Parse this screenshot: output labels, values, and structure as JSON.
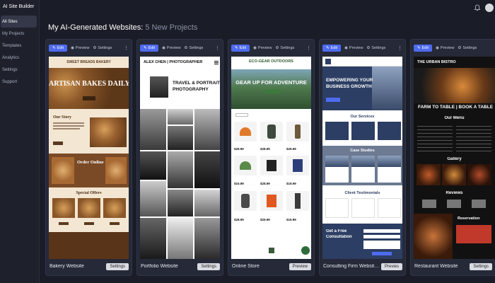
{
  "sidebar": {
    "brand": "AI Site Builder",
    "items": [
      {
        "label": "All Sites",
        "active": true
      },
      {
        "label": "My Projects",
        "active": false
      },
      {
        "label": "Templates",
        "active": false
      },
      {
        "label": "Analytics",
        "active": false
      },
      {
        "label": "Settings",
        "active": false
      },
      {
        "label": "Support",
        "active": false
      }
    ]
  },
  "header": {
    "title": "My AI-Generated Websites:",
    "subtitle": "5 New Projects"
  },
  "toolbar": {
    "edit": "Edit",
    "preview": "Preview",
    "settings": "Settings"
  },
  "cards": [
    {
      "name": "Bakery Website",
      "button": "Settings",
      "site": {
        "brand": "SWEET BREADS BAKERY",
        "hero": "ARTISAN BAKES DAILY",
        "story": "Our Story",
        "online": "Order Online",
        "offers": "Special Offers"
      }
    },
    {
      "name": "Portfolio Website",
      "button": "Settings",
      "site": {
        "brand": "ALEX CHEN | PHOTOGRAPHER",
        "hero_line1": "TRAVEL & PORTRAIT",
        "hero_line2": "PHOTOGRAPHY"
      }
    },
    {
      "name": "Online Store",
      "button": "Preview",
      "site": {
        "brand": "ECO-GEAR OUTDOORS",
        "hero": "GEAR UP FOR ADVENTURE",
        "prices": [
          "$28.99",
          "$28.99",
          "$29.99",
          "$15.99",
          "$28.99",
          "$19.99",
          "$28.99",
          "$29.99",
          "$19.99"
        ]
      }
    },
    {
      "name": "Consulting Firm Website ...",
      "button": "Previes",
      "site": {
        "hero_line1": "EMPOWERING YOUR",
        "hero_line2": "BUSINESS GROWTH",
        "services": "Our Services",
        "cases": "Case Studies",
        "testimonials": "Client Testimonials",
        "cta_line1": "Get a Free",
        "cta_line2": "Consultation"
      }
    },
    {
      "name": "Restaurant Website",
      "button": "Settings",
      "site": {
        "brand": "THE URBAN BISTRO",
        "hero": "FARM TO TABLE | BOOK A TABLE",
        "menu": "Our Menu",
        "gallery": "Gallery",
        "reviews": "Reviews",
        "reservation": "Reservation"
      }
    }
  ],
  "colors": {
    "background": "#1a1d27",
    "card": "#252938",
    "accent": "#4f6bf0",
    "bakery_brown": "#7a4a26",
    "consult_navy": "#2c3e63",
    "bistro_red": "#c0392b"
  }
}
